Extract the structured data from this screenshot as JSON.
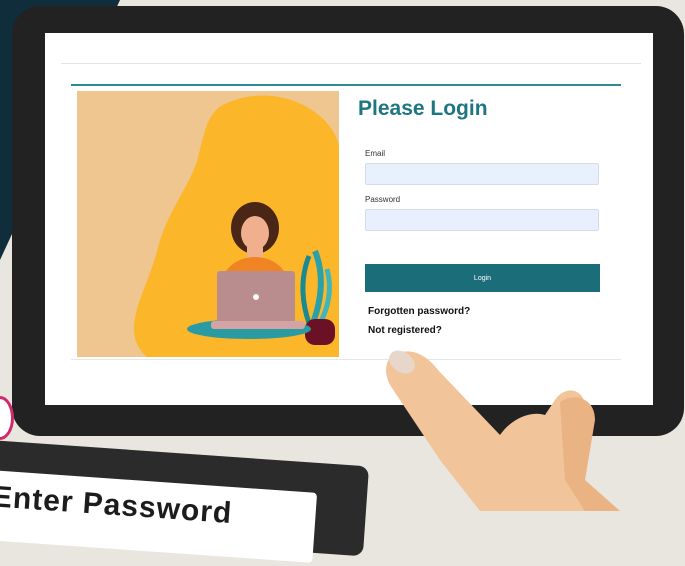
{
  "login": {
    "title": "Please Login",
    "email_label": "Email",
    "email_value": "",
    "password_label": "Password",
    "password_value": "",
    "button_label": "Login",
    "forgot_link": "Forgotten password?",
    "register_link": "Not registered?"
  },
  "sticker": {
    "text": "Enter Password"
  },
  "colors": {
    "accent_teal": "#1f7682",
    "button_teal": "#1b6d79",
    "input_bg": "#e8effd",
    "illustration_bg": "#efc690",
    "blob_yellow": "#fbb62a"
  }
}
